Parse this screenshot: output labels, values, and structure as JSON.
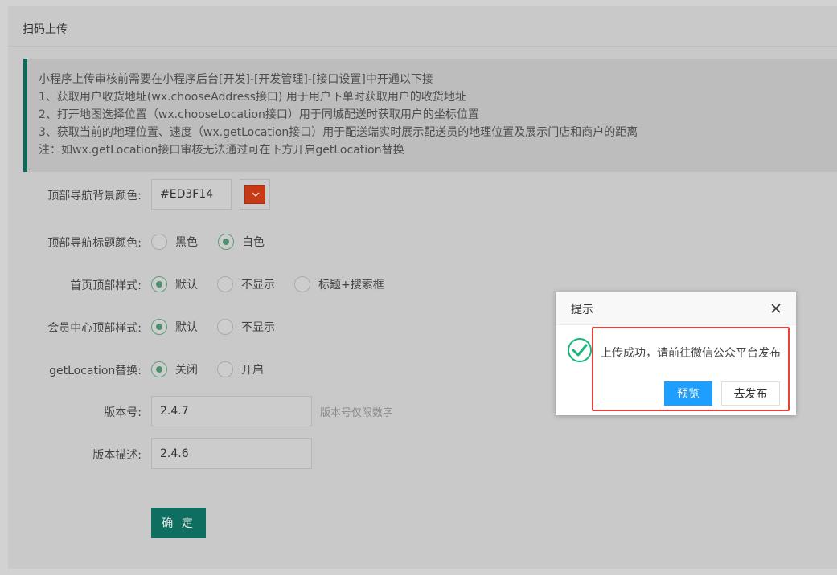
{
  "panel": {
    "title": "扫码上传"
  },
  "notice": {
    "lines": [
      "小程序上传审核前需要在小程序后台[开发]-[开发管理]-[接口设置]中开通以下接",
      "1、获取用户收货地址(wx.chooseAddress接口) 用于用户下单时获取用户的收货地址",
      "2、打开地图选择位置（wx.chooseLocation接口）用于同城配送时获取用户的坐标位置",
      "3、获取当前的地理位置、速度（wx.getLocation接口）用于配送端实时展示配送员的地理位置及展示门店和商户的距离",
      "注：如wx.getLocation接口审核无法通过可在下方开启getLocation替换"
    ]
  },
  "form": {
    "nav_bg_color": {
      "label": "顶部导航背景颜色:",
      "value": "#ED3F14",
      "swatch_color": "#c73a16"
    },
    "nav_title_color": {
      "label": "顶部导航标题颜色:",
      "options": [
        "黑色",
        "白色"
      ],
      "selected": "白色"
    },
    "home_top_style": {
      "label": "首页顶部样式:",
      "options": [
        "默认",
        "不显示",
        "标题+搜索框"
      ],
      "selected": "默认"
    },
    "member_top_style": {
      "label": "会员中心顶部样式:",
      "options": [
        "默认",
        "不显示"
      ],
      "selected": "默认"
    },
    "getlocation_replace": {
      "label": "getLocation替换:",
      "options": [
        "关闭",
        "开启"
      ],
      "selected": "关闭"
    },
    "version": {
      "label": "版本号:",
      "value": "2.4.7",
      "hint": "版本号仅限数字"
    },
    "version_desc": {
      "label": "版本描述:",
      "value": "2.4.6"
    },
    "submit_label": "确 定"
  },
  "dialog": {
    "title": "提示",
    "message": "上传成功，请前往微信公众平台发布",
    "preview_label": "预览",
    "publish_label": "去发布",
    "icon": "check-circle-icon",
    "icon_color": "#16b777"
  },
  "colors": {
    "accent": "#0e6e5f",
    "primary_button": "#1e9fff",
    "highlight_border": "#e8403a"
  }
}
